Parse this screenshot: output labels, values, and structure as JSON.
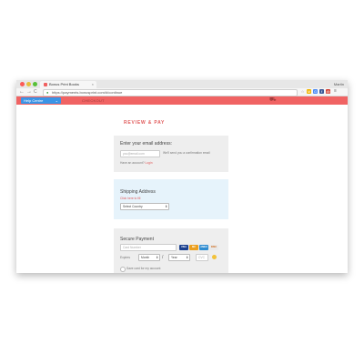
{
  "browser": {
    "tab_title": "Bonus Print Books",
    "tab_close": "×",
    "profile_name": "Martin",
    "url": "https://payments.bonusprint.com/#/continue",
    "lock_icon": "lock-icon",
    "back": "←",
    "forward": "→",
    "reload": "C",
    "extensions": [
      "☆",
      "M",
      "G",
      "f",
      "@",
      "≡"
    ]
  },
  "app": {
    "help_button": "Help Centre",
    "help_chevron": "⌄",
    "checkout_label": "CHECKOUT",
    "cart_icon": "⛟",
    "colors": {
      "appbar": "#f06363",
      "help": "#3a94e6",
      "accent": "#e05a5a"
    }
  },
  "page": {
    "heading": "REVIEW & PAY"
  },
  "email_section": {
    "title": "Enter your email address:",
    "placeholder": "you@email.com",
    "helper": "We'll send you a confirmation email",
    "account_prompt": "Have an account?",
    "login_link": "Login"
  },
  "shipping_section": {
    "title": "Shipping Address",
    "link": "Click here to fill",
    "country_select": "Select Country",
    "select_arrow": "⬍"
  },
  "payment_section": {
    "title": "Secure Payment",
    "card_placeholder": "Card Number",
    "cards": [
      "VISA",
      "MC",
      "AMEX",
      "DISC"
    ],
    "expires_label": "Expires",
    "month_select": "Month",
    "separator": "/",
    "year_select": "Year",
    "cvc_placeholder": "CVC",
    "save_label": "Save card for my account"
  }
}
